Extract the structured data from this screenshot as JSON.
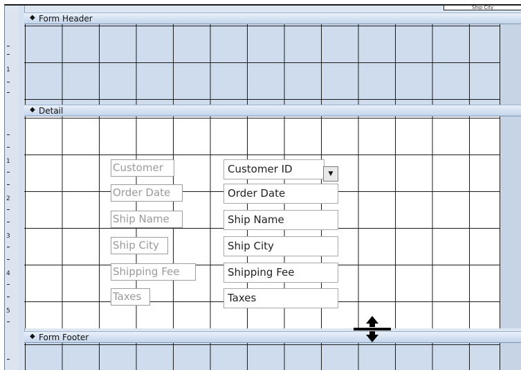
{
  "window": {
    "corner_label": "Ship City"
  },
  "sections": {
    "header": {
      "label": "Form Header",
      "arrow": "◆"
    },
    "detail": {
      "label": "Detail",
      "arrow": "◆"
    },
    "footer": {
      "label": "Form Footer",
      "arrow": "◆"
    }
  },
  "ruler": {
    "numbers": [
      "1",
      "1",
      "2",
      "3",
      "4",
      "5"
    ]
  },
  "controls": [
    {
      "label": "Customer",
      "field": "Customer ID",
      "combo": true
    },
    {
      "label": "Order Date",
      "field": "Order Date"
    },
    {
      "label": "Ship Name",
      "field": "Ship Name"
    },
    {
      "label": "Ship City",
      "field": "Ship City"
    },
    {
      "label": "Shipping Fee",
      "field": "Shipping Fee"
    },
    {
      "label": "Taxes",
      "field": "Taxes"
    }
  ],
  "icons": {
    "combo_dropdown": "chevron-down-icon",
    "resize_cursor": "vertical-resize-icon"
  }
}
